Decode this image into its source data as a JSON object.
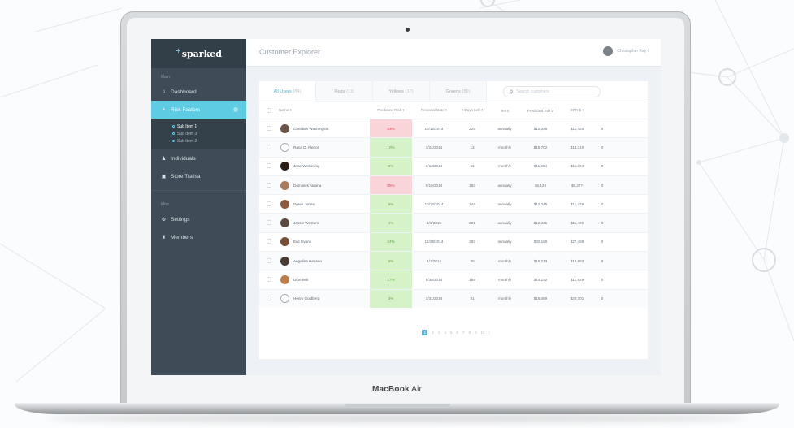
{
  "app": {
    "logo": "sparked",
    "logo_spark": "+",
    "page_title": "Customer Explorer",
    "user_name": "Christopher Kay ◊"
  },
  "sidebar": {
    "label_main": "Main",
    "label_misc": "Misc",
    "items_main": [
      {
        "label": "Dashboard",
        "icon": "home-icon",
        "glyph": "⌂",
        "active": false
      },
      {
        "label": "Risk Factors",
        "icon": "warning-icon",
        "glyph": "▲",
        "active": true
      }
    ],
    "subitems": [
      "Sub Item 1",
      "Sub Item 3",
      "Sub Item 2"
    ],
    "items_after": [
      {
        "label": "Individuals",
        "icon": "user-icon",
        "glyph": "♟"
      },
      {
        "label": "Store Trailsa",
        "icon": "store-icon",
        "glyph": "▣"
      }
    ],
    "items_misc": [
      {
        "label": "Settings",
        "icon": "gear-icon",
        "glyph": "⚙"
      },
      {
        "label": "Members",
        "icon": "members-icon",
        "glyph": "♜"
      }
    ]
  },
  "tabs": [
    {
      "label": "All Users",
      "count": "(84)",
      "on": true
    },
    {
      "label": "Reds",
      "count": "(11)",
      "on": false
    },
    {
      "label": "Yellows",
      "count": "(17)",
      "on": false
    },
    {
      "label": "Greens",
      "count": "(89)",
      "on": false
    }
  ],
  "search": {
    "placeholder": "Search customers"
  },
  "table": {
    "headers": [
      "Name ▾",
      "Predicted Risk ▾",
      "Renewal Date ▾",
      "# Days Left ▾",
      "Term",
      "Predicted EdTV",
      "SRR $ ▾",
      ""
    ],
    "rows": [
      {
        "name": "Christian Washington",
        "risk": "63%",
        "level": "hi",
        "date": "10/12/2014",
        "days": "224",
        "term": "annually",
        "edtv": "$12,345",
        "srr": "$11,420",
        "x": "0",
        "face": "#6d5446"
      },
      {
        "name": "Rana D. Flenor",
        "risk": "10%",
        "level": "lo",
        "date": "3/24/2014",
        "days": "13",
        "term": "monthly",
        "edtv": "$15,702",
        "srr": "$14,310",
        "x": "0",
        "face": "ghost"
      },
      {
        "name": "Jane Westeway",
        "risk": "2%",
        "level": "lo",
        "date": "3/13/2014",
        "days": "11",
        "term": "monthly",
        "edtv": "$11,054",
        "srr": "$11,394",
        "x": "0",
        "face": "#2b1d17"
      },
      {
        "name": "Dominick Aldana",
        "risk": "85%",
        "level": "hi",
        "date": "9/19/2014",
        "days": "183",
        "term": "annually",
        "edtv": "$6,123",
        "srr": "$6,277",
        "x": "0",
        "face": "#a97a5b"
      },
      {
        "name": "Derek Jones",
        "risk": "6%",
        "level": "lo",
        "date": "10/12/2014",
        "days": "244",
        "term": "annually",
        "edtv": "$12,345",
        "srr": "$11,429",
        "x": "0",
        "face": "#8b5a3c"
      },
      {
        "name": "Jessie Western",
        "risk": "4%",
        "level": "lo",
        "date": "1/1/2015",
        "days": "301",
        "term": "annually",
        "edtv": "$12,345",
        "srr": "$11,429",
        "x": "0",
        "face": "#5e4a41"
      },
      {
        "name": "Eric Evans",
        "risk": "24%",
        "level": "lo",
        "date": "12/28/2014",
        "days": "283",
        "term": "annually",
        "edtv": "$32,189",
        "srr": "$27,499",
        "x": "0",
        "face": "#7a4e35"
      },
      {
        "name": "Angelina Hensen",
        "risk": "6%",
        "level": "lo",
        "date": "4/1/2014",
        "days": "30",
        "term": "monthly",
        "edtv": "$16,213",
        "srr": "$19,683",
        "x": "0",
        "face": "#4a3b34"
      },
      {
        "name": "Dion Wik",
        "risk": "17%",
        "level": "lo",
        "date": "6/30/2014",
        "days": "189",
        "term": "monthly",
        "edtv": "$14,232",
        "srr": "$11,929",
        "x": "0",
        "face": "#c07c47"
      },
      {
        "name": "Henry Goldberg",
        "risk": "3%",
        "level": "lo",
        "date": "3/31/2014",
        "days": "31",
        "term": "monthly",
        "edtv": "$15,089",
        "srr": "$20,701",
        "x": "0",
        "face": "ghost"
      }
    ]
  },
  "pager": {
    "prev": "‹",
    "pages": [
      "1",
      "2",
      "3",
      "4",
      "5",
      "6",
      "7",
      "8",
      "9",
      "10"
    ],
    "current": "1",
    "next": "›"
  },
  "device": {
    "brand_bold": "MacBook",
    "brand_rest": " Air"
  }
}
